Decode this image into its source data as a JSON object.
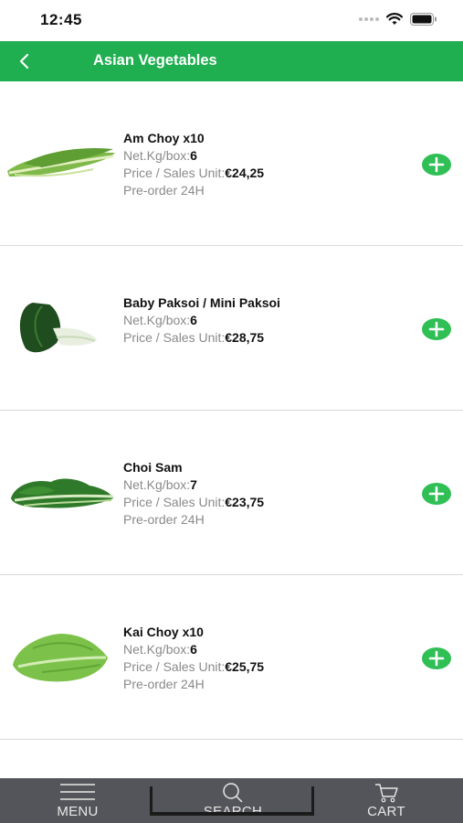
{
  "status_bar": {
    "time": "12:45"
  },
  "header": {
    "title": "Asian Vegetables"
  },
  "labels": {
    "net_kg": "Net.Kg/box:",
    "price": "Price / Sales Unit:"
  },
  "products": [
    {
      "name": "Am Choy x10",
      "net_kg": "6",
      "price": "€24,25",
      "note": "Pre-order 24H",
      "image_icon": "am-choy-image"
    },
    {
      "name": "Baby Paksoi / Mini Paksoi",
      "net_kg": "6",
      "price": "€28,75",
      "note": "",
      "image_icon": "baby-paksoi-image"
    },
    {
      "name": "Choi Sam",
      "net_kg": "7",
      "price": "€23,75",
      "note": "Pre-order 24H",
      "image_icon": "choi-sam-image"
    },
    {
      "name": "Kai Choy x10",
      "net_kg": "6",
      "price": "€25,75",
      "note": "Pre-order 24H",
      "image_icon": "kai-choy-image"
    }
  ],
  "tabs": {
    "menu": "MENU",
    "search": "SEARCH",
    "cart": "CART"
  },
  "colors": {
    "brand_green": "#1fae50",
    "add_button": "#2fbf55",
    "tab_bar": "#54555a"
  }
}
